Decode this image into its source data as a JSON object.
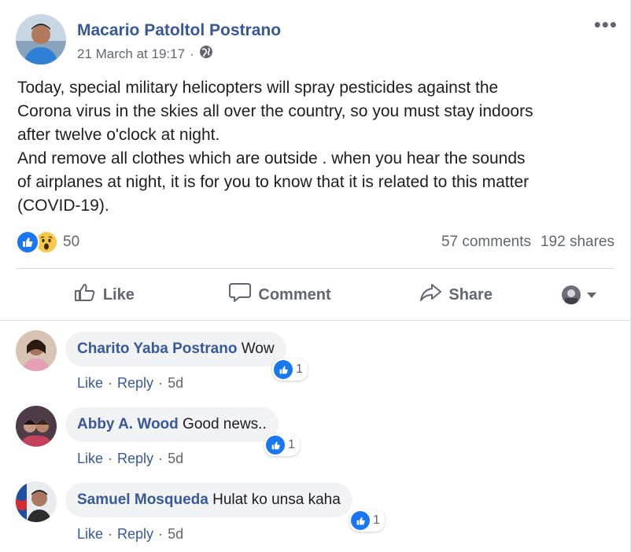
{
  "post": {
    "author": "Macario Patoltol Postrano",
    "timestamp": "21 March at 19:17",
    "separator": "·",
    "audience_icon": "globe-icon",
    "more_label": "•••",
    "text_lines": [
      "Today, special military helicopters will spray pesticides against the",
      "Corona virus in the skies all over the country, so you must stay indoors",
      "after twelve o'clock at night.",
      "And remove all clothes which are outside . when you hear the sounds",
      "of airplanes at night, it is for you to know that it is related to this matter",
      "(COVID-19)."
    ],
    "reaction_count": "50",
    "reactions": [
      "like-icon",
      "wow-icon"
    ],
    "comments_count": "57 comments",
    "shares_count": "192 shares"
  },
  "actions": {
    "like": "Like",
    "comment": "Comment",
    "share": "Share"
  },
  "comments": [
    {
      "name": "Charito Yaba Postrano",
      "text": "Wow",
      "likes": "1",
      "like_label": "Like",
      "reply_label": "Reply",
      "age": "5d",
      "sep": "·"
    },
    {
      "name": "Abby A. Wood",
      "text": "Good news..",
      "likes": "1",
      "like_label": "Like",
      "reply_label": "Reply",
      "age": "5d",
      "sep": "·"
    },
    {
      "name": "Samuel Mosqueda",
      "text": "Hulat ko unsa kaha",
      "likes": "1",
      "like_label": "Like",
      "reply_label": "Reply",
      "age": "5d",
      "sep": "·"
    }
  ],
  "colors": {
    "link": "#385898",
    "muted": "#606770",
    "like_blue": "#1877f2",
    "wow_yellow": "#f7c94a",
    "bubble": "#f2f3f5"
  }
}
